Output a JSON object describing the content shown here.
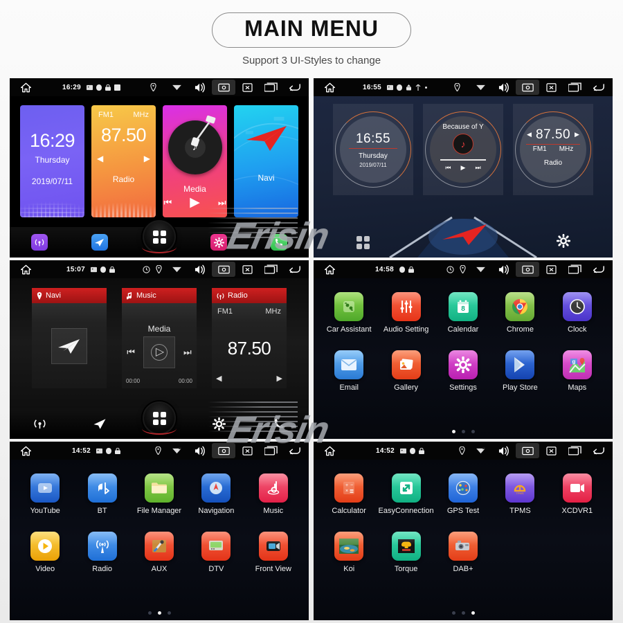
{
  "header": {
    "title": "MAIN MENU",
    "subtitle": "Support 3 UI-Styles to change"
  },
  "watermark": {
    "text": "Erisin"
  },
  "statusbar_icons": {
    "home": "home-icon",
    "screenshot": "screenshot-icon",
    "close": "close-box-icon",
    "recents": "recents-icon",
    "back": "back-icon",
    "volume": "volume-icon",
    "location": "location-icon",
    "wifi": "wifi-icon"
  },
  "panels": [
    {
      "id": "panel-style-1-colored-tiles",
      "statusbar": {
        "time": "16:29"
      },
      "tiles": [
        {
          "name": "clock",
          "time": "16:29",
          "weekday": "Thursday",
          "date": "2019/07/11"
        },
        {
          "name": "radio",
          "band": "FM1",
          "unit": "MHz",
          "frequency": "87.50",
          "label": "Radio"
        },
        {
          "name": "media",
          "label": "Media"
        },
        {
          "name": "navi",
          "label": "Navi"
        }
      ],
      "dock": [
        "radio",
        "navi",
        "all-apps",
        "settings",
        "phone"
      ]
    },
    {
      "id": "panel-style-2-circular-widgets",
      "statusbar": {
        "time": "16:55"
      },
      "cards": [
        {
          "name": "clock",
          "time": "16:55",
          "weekday": "Thursday",
          "date": "2019/07/11"
        },
        {
          "name": "music",
          "track": "Because of Y"
        },
        {
          "name": "radio",
          "frequency": "87.50",
          "band": "FM1",
          "unit": "MHz",
          "label": "Radio"
        }
      ],
      "dock": [
        "all-apps",
        "navi",
        "settings"
      ]
    },
    {
      "id": "panel-style-3-dark-cards",
      "statusbar": {
        "time": "15:07"
      },
      "cards": [
        {
          "name": "navi",
          "title": "Navi"
        },
        {
          "name": "music",
          "title": "Music",
          "label": "Media",
          "elapsed": "00:00",
          "duration": "00:00"
        },
        {
          "name": "radio",
          "title": "Radio",
          "band": "FM1",
          "unit": "MHz",
          "frequency": "87.50"
        }
      ],
      "dock": [
        "radio",
        "navi",
        "all-apps",
        "settings",
        "phone"
      ]
    },
    {
      "id": "panel-apps-page-1",
      "statusbar": {
        "time": "14:58"
      },
      "apps": [
        {
          "label": "Car Assistant",
          "icon": "car-assistant-icon",
          "color": "#6dbe3a"
        },
        {
          "label": "Audio Setting",
          "icon": "audio-setting-icon",
          "color": "#f2472b"
        },
        {
          "label": "Calendar",
          "icon": "calendar-icon",
          "color": "#21c49a"
        },
        {
          "label": "Chrome",
          "icon": "chrome-icon",
          "color": "#7fc242"
        },
        {
          "label": "Clock",
          "icon": "clock-icon",
          "color": "#5b4bd6"
        },
        {
          "label": "Email",
          "icon": "email-icon",
          "color": "#3f96ea"
        },
        {
          "label": "Gallery",
          "icon": "gallery-icon",
          "color": "#f2502b"
        },
        {
          "label": "Settings",
          "icon": "settings-icon",
          "color": "#cf32c0"
        },
        {
          "label": "Play Store",
          "icon": "play-store-icon",
          "color": "#1d58c9"
        },
        {
          "label": "Maps",
          "icon": "maps-icon",
          "color": "#d846c8"
        }
      ],
      "pager": {
        "count": 3,
        "active": 0
      }
    },
    {
      "id": "panel-apps-page-2",
      "statusbar": {
        "time": "14:52"
      },
      "apps": [
        {
          "label": "YouTube",
          "icon": "youtube-icon",
          "color": "#2b6fe0"
        },
        {
          "label": "BT",
          "icon": "bluetooth-icon",
          "color": "#2f86e8"
        },
        {
          "label": "File Manager",
          "icon": "file-manager-icon",
          "color": "#7ac142"
        },
        {
          "label": "Navigation",
          "icon": "navigation-icon",
          "color": "#1f6fd6"
        },
        {
          "label": "Music",
          "icon": "music-icon",
          "color": "#ef4060"
        },
        {
          "label": "Video",
          "icon": "video-icon",
          "color": "#f2b705"
        },
        {
          "label": "Radio",
          "icon": "radio-icon",
          "color": "#2f86e8"
        },
        {
          "label": "AUX",
          "icon": "aux-icon",
          "color": "#f2472b"
        },
        {
          "label": "DTV",
          "icon": "dtv-icon",
          "color": "#f2472b"
        },
        {
          "label": "Front View",
          "icon": "front-view-icon",
          "color": "#f2472b"
        }
      ],
      "pager": {
        "count": 3,
        "active": 1
      }
    },
    {
      "id": "panel-apps-page-3",
      "statusbar": {
        "time": "14:52"
      },
      "apps": [
        {
          "label": "Calculator",
          "icon": "calculator-icon",
          "color": "#f2512b"
        },
        {
          "label": "EasyConnection",
          "icon": "easyconnection-icon",
          "color": "#21c48a"
        },
        {
          "label": "GPS Test",
          "icon": "gps-test-icon",
          "color": "#2f7fe8"
        },
        {
          "label": "TPMS",
          "icon": "tpms-icon",
          "color": "#7a4cd6"
        },
        {
          "label": "XCDVR1",
          "icon": "xcdvr-icon",
          "color": "#ef3b5b"
        },
        {
          "label": "Koi",
          "icon": "koi-icon",
          "color": "#f2512b"
        },
        {
          "label": "Torque",
          "icon": "torque-icon",
          "color": "#21c48a"
        },
        {
          "label": "DAB+",
          "icon": "dab-icon",
          "color": "#f2512b"
        }
      ],
      "pager": {
        "count": 3,
        "active": 2
      }
    }
  ]
}
